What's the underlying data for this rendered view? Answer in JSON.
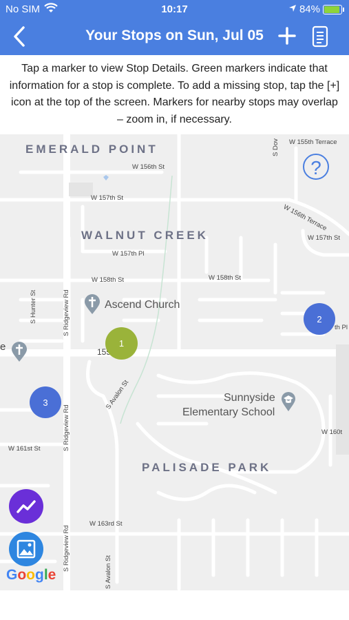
{
  "status_bar": {
    "carrier": "No SIM",
    "time": "10:17",
    "battery": "84%"
  },
  "header": {
    "title": "Your Stops on Sun, Jul 05",
    "back_icon": "chevron-left-icon",
    "add_icon": "plus-icon",
    "list_icon": "document-icon"
  },
  "instructions": "Tap a marker to view Stop Details. Green markers indicate that information for a stop is complete. To add a missing stop, tap the [+] icon at the top of the screen. Markers for nearby stops may overlap – zoom in, if necessary.",
  "map": {
    "areas": [
      "EMERALD POINT",
      "WALNUT CREEK",
      "PALISADE PARK"
    ],
    "streets": [
      "W 155th Terrace",
      "W 156th St",
      "W 157th St",
      "W 156th Terrace",
      "W 157th Pl",
      "W 157th St",
      "W 158th St",
      "W 158th St",
      "S Hunter St",
      "S Ridgeview Rd",
      "S Avalon St",
      "S Ridgeview Rd",
      "W 161st St",
      "W 160t",
      "S Ridgeview Rd",
      "W 163rd St",
      "S Avalon St",
      "S Dov",
      "th Pl",
      "155",
      "e"
    ],
    "pois": {
      "church": "Ascend Church",
      "school_line1": "Sunnyside",
      "school_line2": "Elementary School"
    },
    "markers": [
      {
        "label": "1",
        "status": "complete",
        "color": "#9ab33a"
      },
      {
        "label": "2",
        "status": "incomplete",
        "color": "#4a6fd6"
      },
      {
        "label": "3",
        "status": "incomplete",
        "color": "#4a6fd6"
      }
    ],
    "help_label": "?",
    "google_logo": "Google"
  },
  "colors": {
    "header": "#4a7fe0",
    "complete": "#9ab33a",
    "incomplete": "#4a6fd6",
    "fab_analytics": "#6a2fd8",
    "fab_image": "#2e86e0"
  }
}
